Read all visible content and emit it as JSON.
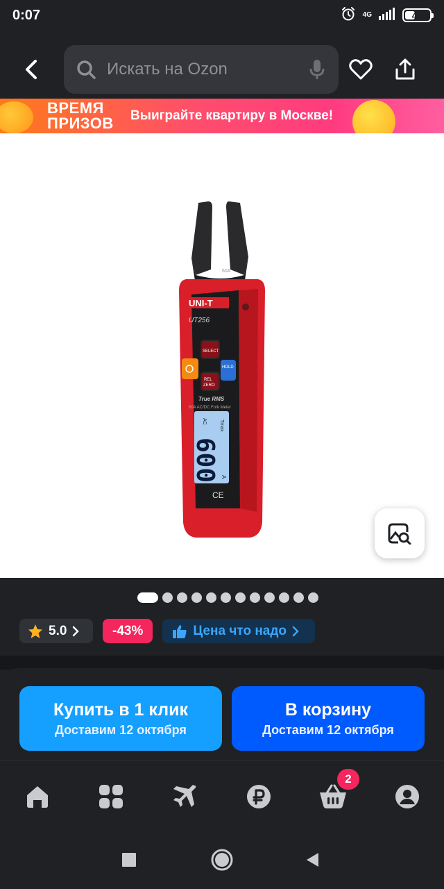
{
  "status_bar": {
    "time": "0:07",
    "network": "4G",
    "battery": "40",
    "battery_level": 0.4
  },
  "top_bar": {
    "search_placeholder": "Искать на Ozon",
    "icons": [
      "back-arrow-icon",
      "search-icon",
      "microphone-icon",
      "heart-icon",
      "share-icon"
    ]
  },
  "promo": {
    "title_line1": "ВРЕМЯ",
    "title_line2": "ПРИЗОВ",
    "text": "Выиграйте квартиру в Москве!"
  },
  "product": {
    "brand": "UNI-T",
    "model": "UT256",
    "key_select": "SELECT",
    "key_hold": "HOLD",
    "key_rel": "REL",
    "key_zero": "ZERO",
    "caption_rms": "True RMS",
    "caption_desc": "60A AC/DC Fork Meter",
    "lcd_mode": "AC",
    "lcd_max": "Tmax",
    "lcd_value": "600",
    "lcd_unit": "A",
    "mark_ce": "CE",
    "range_mark": "60A",
    "image_count": 12,
    "active_image": 1
  },
  "badges": {
    "rating": "5.0",
    "discount": "-43%",
    "price_label": "Цена что надо"
  },
  "actions": {
    "buy_label": "Купить в 1 клик",
    "buy_sub": "Доставим 12 октября",
    "cart_label": "В корзину",
    "cart_sub": "Доставим 12 октября"
  },
  "bottom_nav": {
    "items": [
      "home-icon",
      "catalog-icon",
      "travel-icon",
      "ruble-icon",
      "cart-icon",
      "profile-icon"
    ],
    "cart_badge": "2"
  },
  "colors": {
    "background": "#1f2124",
    "buy_button": "#15a0ff",
    "cart_button": "#005bff",
    "discount": "#f5265d",
    "price_chip_text": "#3aa6ff",
    "rating_star": "#ffb21f"
  }
}
